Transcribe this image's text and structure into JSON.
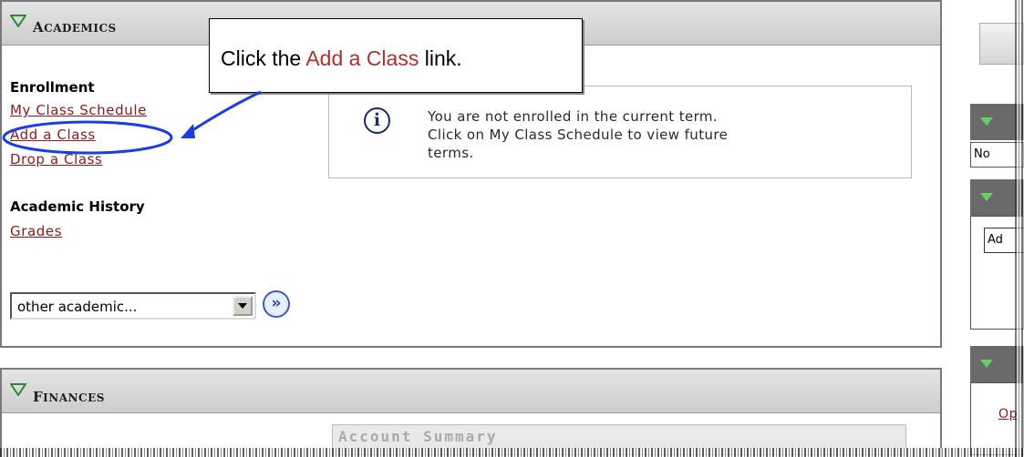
{
  "academics": {
    "title_first": "A",
    "title_rest": "CADEMICS",
    "enrollment_heading": "Enrollment",
    "enrollment_links": [
      "My Class Schedule",
      "Add a Class",
      "Drop a Class"
    ],
    "history_heading": "Academic History",
    "history_links": [
      "Grades"
    ],
    "select_value": "other academic...",
    "go_icon": "»",
    "notice_icon": "i",
    "notice_text_line1": "You are not enrolled in the current term.",
    "notice_text_line2": "Click on My Class Schedule to view future",
    "notice_text_line3": "terms."
  },
  "callout": {
    "prefix": "Click the ",
    "link": "Add a Class",
    "suffix": " link."
  },
  "finances": {
    "title_first": "F",
    "title_rest": "INANCES",
    "account_summary": "Account Summary"
  },
  "right_sidebar": {
    "section2_text": "No",
    "section3_input": "Ad",
    "section4_link": "Op"
  },
  "colors": {
    "link": "#8b1a1a",
    "callout_link": "#b03030",
    "annotation": "#1a3fe0",
    "triangle": "#2f8a2f"
  }
}
